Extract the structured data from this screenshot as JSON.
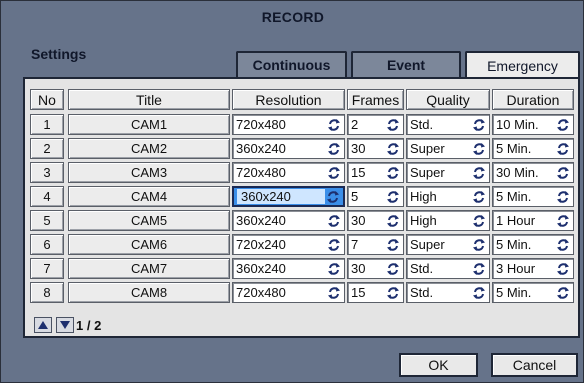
{
  "window": {
    "title": "RECORD"
  },
  "settings_label": "Settings",
  "tabs": [
    {
      "label": "Continuous",
      "active": false
    },
    {
      "label": "Event",
      "active": false
    },
    {
      "label": "Emergency",
      "active": true
    }
  ],
  "table": {
    "headers": {
      "no": "No",
      "title": "Title",
      "resolution": "Resolution",
      "frames": "Frames",
      "quality": "Quality",
      "duration": "Duration"
    },
    "rows": [
      {
        "no": "1",
        "title": "CAM1",
        "resolution": "720x480",
        "frames": "2",
        "quality": "Std.",
        "duration": "10 Min."
      },
      {
        "no": "2",
        "title": "CAM2",
        "resolution": "360x240",
        "frames": "30",
        "quality": "Super",
        "duration": "5 Min."
      },
      {
        "no": "3",
        "title": "CAM3",
        "resolution": "720x480",
        "frames": "15",
        "quality": "Super",
        "duration": "30 Min."
      },
      {
        "no": "4",
        "title": "CAM4",
        "resolution": "360x240",
        "frames": "5",
        "quality": "High",
        "duration": "5 Min."
      },
      {
        "no": "5",
        "title": "CAM5",
        "resolution": "360x240",
        "frames": "30",
        "quality": "High",
        "duration": "1 Hour"
      },
      {
        "no": "6",
        "title": "CAM6",
        "resolution": "720x240",
        "frames": "7",
        "quality": "Super",
        "duration": "5 Min."
      },
      {
        "no": "7",
        "title": "CAM7",
        "resolution": "360x240",
        "frames": "30",
        "quality": "Std.",
        "duration": "3 Hour"
      },
      {
        "no": "8",
        "title": "CAM8",
        "resolution": "720x480",
        "frames": "15",
        "quality": "Std.",
        "duration": "5 Min."
      }
    ],
    "selected_row": 3,
    "selected_column": "resolution"
  },
  "pagination": {
    "text": "1 / 2",
    "up_icon": "arrow-up-icon",
    "down_icon": "arrow-down-icon"
  },
  "buttons": {
    "ok": "OK",
    "cancel": "Cancel"
  },
  "colors": {
    "background": "#66738a",
    "panel": "#e4e4e4",
    "selection": "#3b8ee8",
    "spin_icon": "#1d2f6e"
  }
}
